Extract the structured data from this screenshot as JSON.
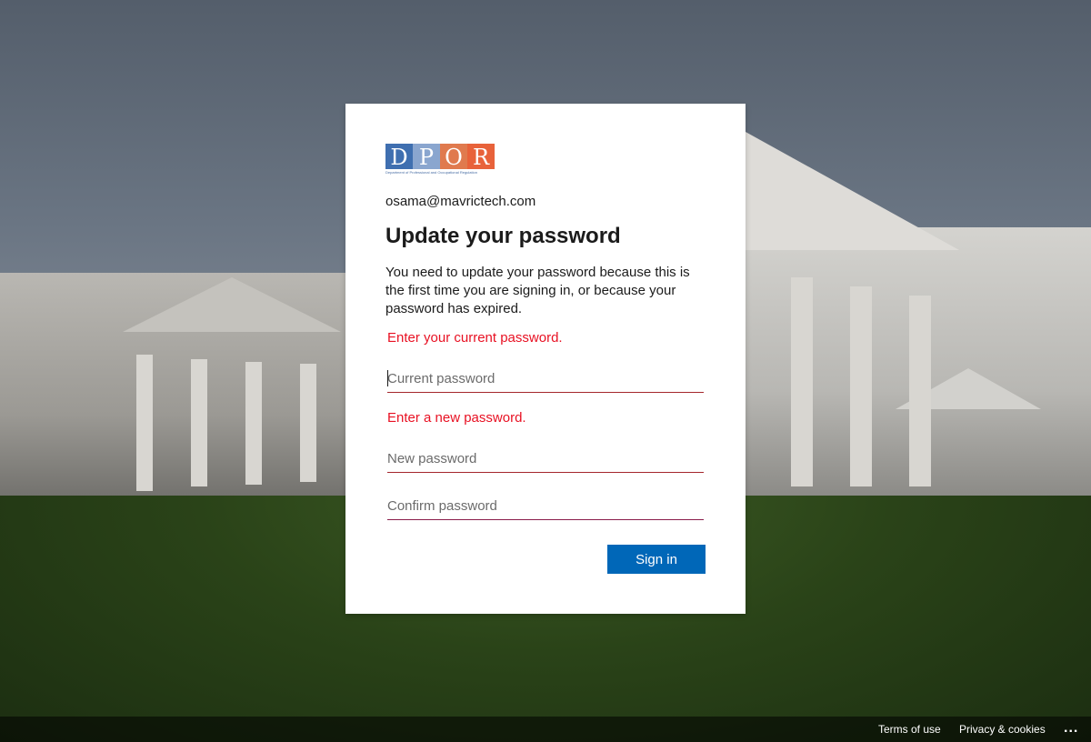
{
  "branding": {
    "logo_letters": [
      "D",
      "P",
      "O",
      "R"
    ],
    "logo_tagline": "Department of Professional and Occupational Regulation",
    "logo_colors": [
      "#3f6fb0",
      "#8aa6cf",
      "#e07a4e",
      "#e8623a"
    ]
  },
  "identity": {
    "email": "osama@mavrictech.com"
  },
  "header": {
    "title": "Update your password"
  },
  "description": "You need to update your password because this is the first time you are signing in, or because your password has expired.",
  "form": {
    "current_error": "Enter your current password.",
    "current_placeholder": "Current password",
    "new_error": "Enter a new password.",
    "new_placeholder": "New password",
    "confirm_placeholder": "Confirm password",
    "submit_label": "Sign in"
  },
  "footer": {
    "terms_label": "Terms of use",
    "privacy_label": "Privacy & cookies",
    "more_label": "..."
  },
  "colors": {
    "accent": "#0067b8",
    "error": "#e81123"
  }
}
